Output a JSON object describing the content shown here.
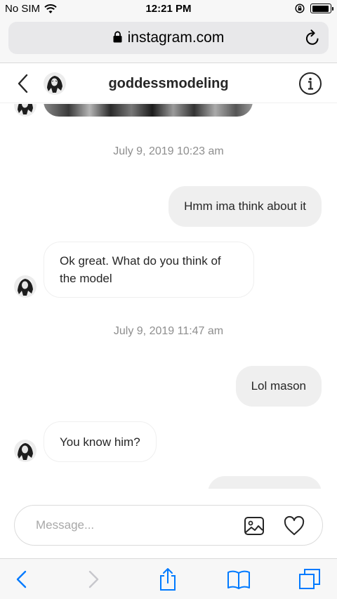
{
  "status_bar": {
    "carrier": "No SIM",
    "time": "12:21 PM",
    "battery_level": 0.95
  },
  "browser": {
    "url": "instagram.com",
    "icons": [
      "lock-icon",
      "reload-icon"
    ]
  },
  "dm_header": {
    "username": "goddessmodeling",
    "icons": [
      "back-icon",
      "info-icon"
    ]
  },
  "messages": [
    {
      "type": "timestamp",
      "text": "July 9, 2019 10:23 am"
    },
    {
      "type": "outgoing",
      "text": "Hmm ima think about it"
    },
    {
      "type": "incoming",
      "text": "Ok great. What do you think of the model"
    },
    {
      "type": "timestamp",
      "text": "July 9, 2019 11:47 am"
    },
    {
      "type": "outgoing",
      "text": "Lol mason"
    },
    {
      "type": "incoming",
      "text": "You know him?"
    }
  ],
  "composer": {
    "placeholder": "Message...",
    "value": "",
    "icons": [
      "gallery-icon",
      "heart-icon"
    ]
  },
  "safari_toolbar": {
    "icons": [
      "back-arrow-icon",
      "forward-arrow-icon",
      "share-icon",
      "bookmarks-icon",
      "tabs-icon"
    ]
  },
  "colors": {
    "bubble_outgoing": "#efefef",
    "bubble_incoming_border": "#efefef",
    "timestamp_text": "#8e8e8e",
    "safari_blue": "#007aff"
  }
}
